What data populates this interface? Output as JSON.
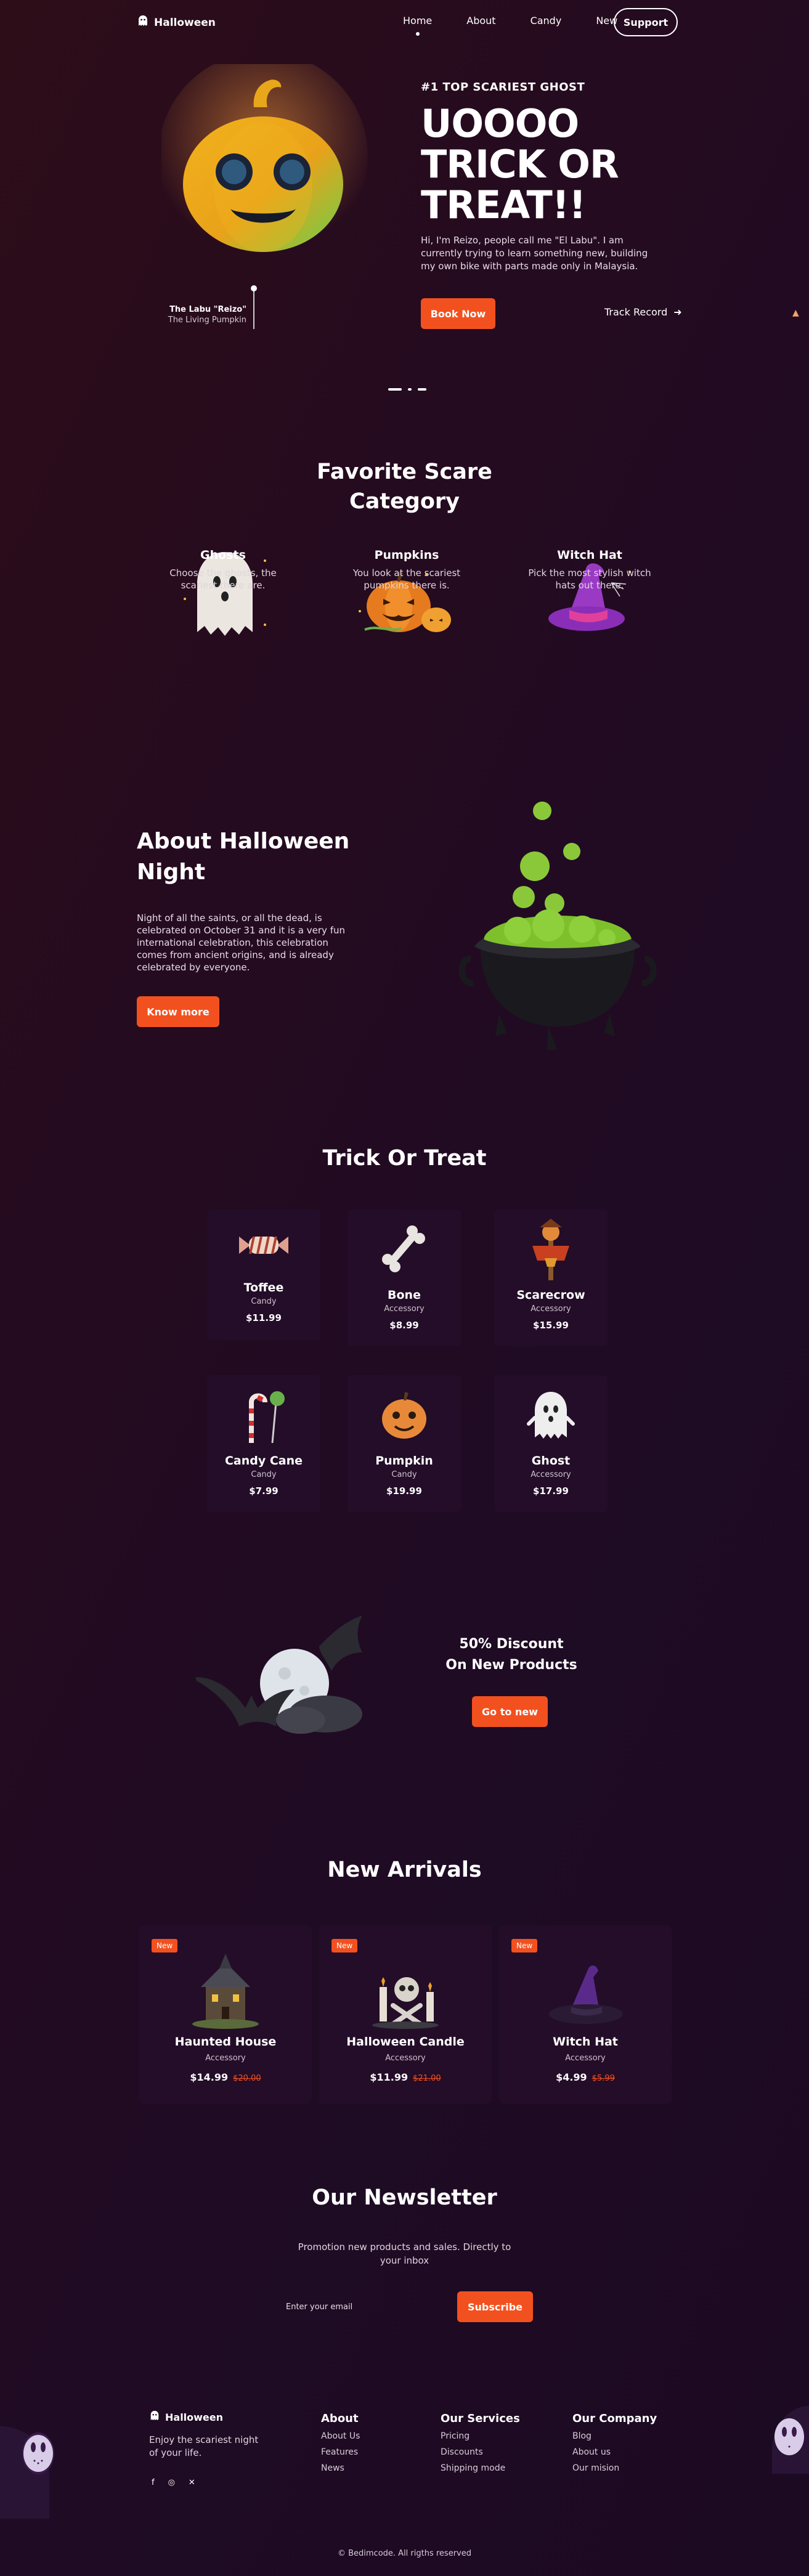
{
  "header": {
    "logo_text": "Halloween",
    "nav": [
      {
        "label": "Home",
        "active": true
      },
      {
        "label": "About",
        "active": false
      },
      {
        "label": "Candy",
        "active": false
      },
      {
        "label": "New",
        "active": false
      }
    ],
    "support_label": "Support"
  },
  "hero": {
    "tag": "#1 TOP SCARIEST GHOST",
    "title_line1": "UOOOO",
    "title_line2": "TRICK OR",
    "title_line3": "TREAT!!",
    "description": "Hi, I'm Reizo, people call me \"El Labu\". I am currently trying to learn something new, building my own bike with parts made only in Malaysia.",
    "book_label": "Book Now",
    "track_label": "Track Record",
    "pumpkin_name": "The Labu \"Reizo\"",
    "pumpkin_sub": "The Living Pumpkin"
  },
  "categories": {
    "title_line1": "Favorite Scare",
    "title_line2": "Category",
    "items": [
      {
        "name": "Ghosts",
        "desc": "Choose the ghosts, the scariest there are.",
        "icon": "ghost-icon"
      },
      {
        "name": "Pumpkins",
        "desc": "You look at the scariest pumpkins there is.",
        "icon": "pumpkin-icon"
      },
      {
        "name": "Witch Hat",
        "desc": "Pick the most stylish witch hats out there.",
        "icon": "witch-hat-icon"
      }
    ]
  },
  "about": {
    "title_line1": "About Halloween",
    "title_line2": "Night",
    "description": "Night of all the saints, or all the dead, is celebrated on October 31 and it is a very fun international celebration, this celebration comes from ancient origins, and is already celebrated by everyone.",
    "button_label": "Know more"
  },
  "trick": {
    "title": "Trick Or Treat",
    "products": [
      {
        "name": "Toffee",
        "type": "Candy",
        "price": "$11.99"
      },
      {
        "name": "Bone",
        "type": "Accessory",
        "price": "$8.99"
      },
      {
        "name": "Scarecrow",
        "type": "Accessory",
        "price": "$15.99"
      },
      {
        "name": "Candy Cane",
        "type": "Candy",
        "price": "$7.99"
      },
      {
        "name": "Pumpkin",
        "type": "Candy",
        "price": "$19.99"
      },
      {
        "name": "Ghost",
        "type": "Accessory",
        "price": "$17.99"
      }
    ]
  },
  "discount": {
    "title_line1": "50% Discount",
    "title_line2": "On New Products",
    "button_label": "Go to new"
  },
  "arrivals": {
    "title": "New Arrivals",
    "items": [
      {
        "badge": "New",
        "name": "Haunted House",
        "type": "Accessory",
        "price": "$14.99",
        "old_price": "$20.00"
      },
      {
        "badge": "New",
        "name": "Halloween Candle",
        "type": "Accessory",
        "price": "$11.99",
        "old_price": "$21.00"
      },
      {
        "badge": "New",
        "name": "Witch Hat",
        "type": "Accessory",
        "price": "$4.99",
        "old_price": "$5.99"
      }
    ]
  },
  "newsletter": {
    "title": "Our Newsletter",
    "subtitle": "Promotion new products and sales. Directly to your inbox",
    "input_placeholder": "Enter your email",
    "button_label": "Subscribe"
  },
  "footer": {
    "logo_text": "Halloween",
    "tagline": "Enjoy the scariest night of your life.",
    "social": [
      "f",
      "◎",
      "✕"
    ],
    "columns": [
      {
        "title": "About",
        "links": [
          "About Us",
          "Features",
          "News"
        ]
      },
      {
        "title": "Our Services",
        "links": [
          "Pricing",
          "Discounts",
          "Shipping mode"
        ]
      },
      {
        "title": "Our Company",
        "links": [
          "Blog",
          "About us",
          "Our mision"
        ]
      }
    ],
    "copyright": "© Bedimcode. All rigths reserved"
  },
  "colors": {
    "accent": "#f2511f",
    "background": "#250b1f",
    "card": "#230d28"
  }
}
